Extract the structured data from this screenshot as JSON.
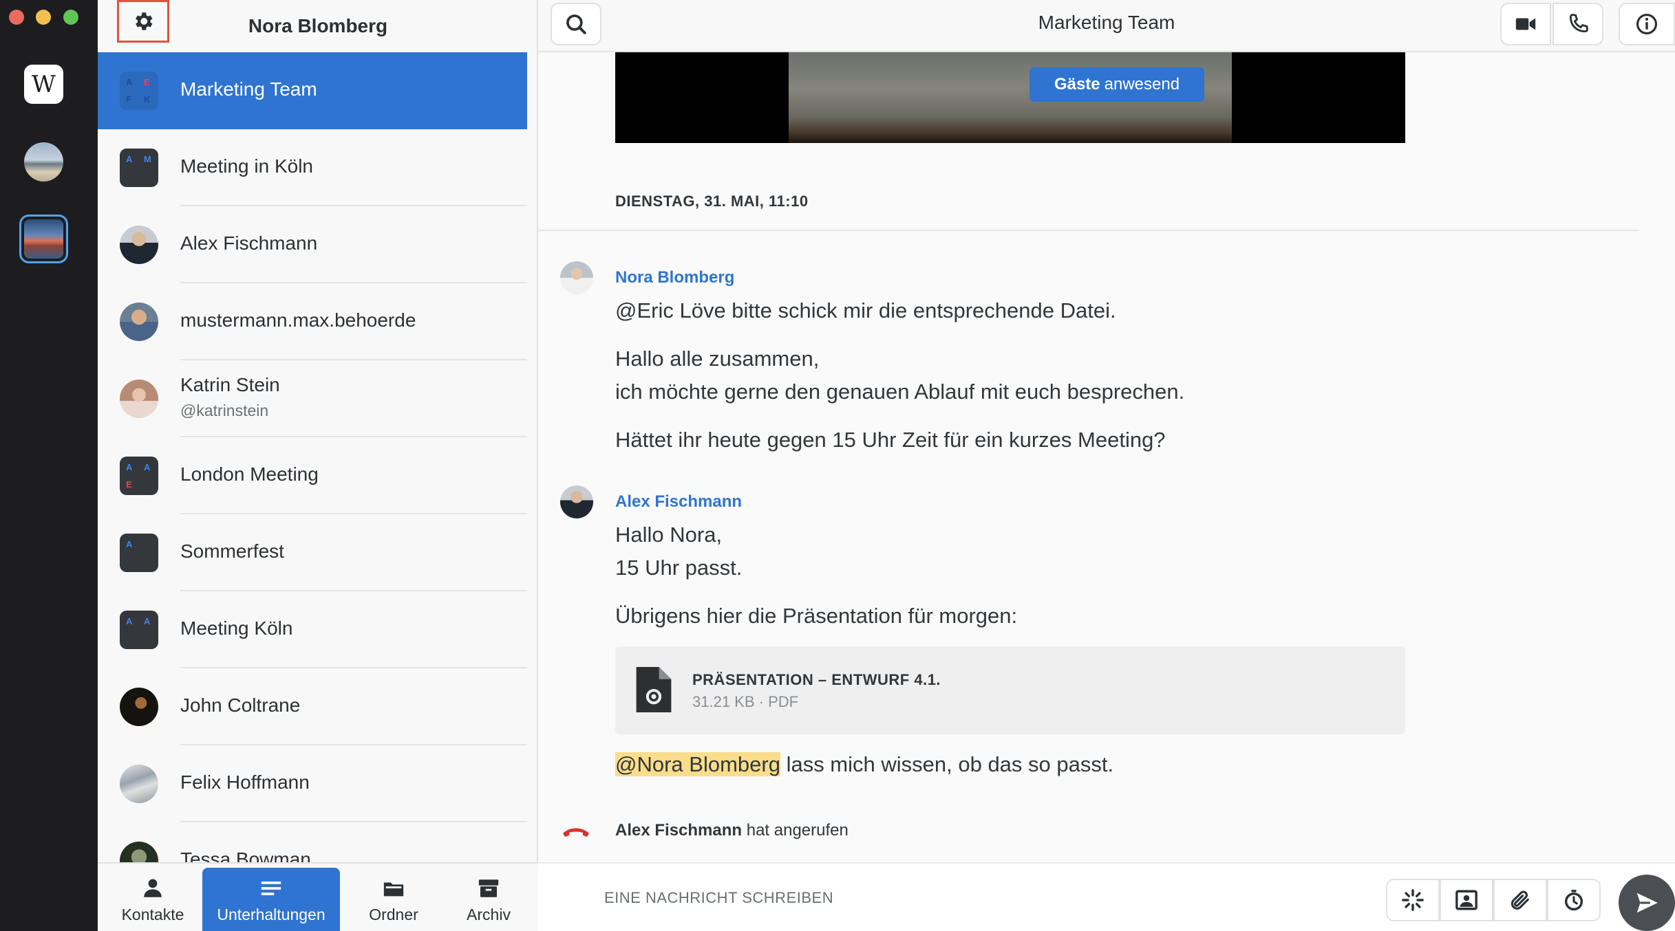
{
  "sidebar": {
    "header_title": "Nora Blomberg",
    "conversations": [
      {
        "name": "Marketing Team",
        "sub": "",
        "type": "group",
        "initials": [
          "A",
          "E",
          "F",
          "K"
        ],
        "active": true
      },
      {
        "name": "Meeting in Köln",
        "sub": "",
        "type": "group",
        "initials": [
          "A",
          "M"
        ]
      },
      {
        "name": "Alex Fischmann",
        "sub": "",
        "type": "person"
      },
      {
        "name": "mustermann.max.behoerde",
        "sub": "",
        "type": "person"
      },
      {
        "name": "Katrin Stein",
        "sub": "@katrinstein",
        "type": "person"
      },
      {
        "name": "London Meeting",
        "sub": "",
        "type": "group",
        "initials": [
          "A",
          "A",
          "E"
        ]
      },
      {
        "name": "Sommerfest",
        "sub": "",
        "type": "group",
        "initials": [
          "A"
        ]
      },
      {
        "name": "Meeting Köln",
        "sub": "",
        "type": "group",
        "initials": [
          "A",
          "A"
        ]
      },
      {
        "name": "John Coltrane",
        "sub": "",
        "type": "person"
      },
      {
        "name": "Felix Hoffmann",
        "sub": "",
        "type": "person"
      },
      {
        "name": "Tessa Bowman",
        "sub": "",
        "type": "person"
      }
    ],
    "nav": [
      {
        "label": "Kontakte",
        "icon": "person-icon"
      },
      {
        "label": "Unterhaltungen",
        "icon": "conversations-icon",
        "active": true
      },
      {
        "label": "Ordner",
        "icon": "folder-icon"
      },
      {
        "label": "Archiv",
        "icon": "archive-icon"
      }
    ]
  },
  "rail": {
    "app_logo": "W"
  },
  "main": {
    "title": "Marketing Team",
    "guests_badge": {
      "strong": "Gäste",
      "rest": "anwesend"
    },
    "date_separator": "DIENSTAG, 31. MAI, 11:10",
    "messages": [
      {
        "sender": "Nora Blomberg",
        "lines": [
          "@Eric Löve bitte schick mir die entsprechende Datei.",
          "Hallo alle zusammen,",
          "ich möchte gerne den genauen Ablauf mit euch besprechen.",
          "Hättet ihr heute gegen 15 Uhr Zeit für ein kurzes Meeting?"
        ]
      },
      {
        "sender": "Alex Fischmann",
        "lines": [
          "Hallo Nora,",
          "15 Uhr passt.",
          "Übrigens hier die Präsentation für morgen:"
        ]
      }
    ],
    "file": {
      "name": "PRÄSENTATION – ENTWURF 4.1.",
      "meta": "31.21 KB · PDF"
    },
    "mention": {
      "tag": "@Nora Blomberg",
      "rest": " lass mich wissen, ob das so passt."
    },
    "call_event": {
      "name": "Alex Fischmann",
      "rest": " hat angerufen"
    },
    "composer": {
      "placeholder": "EINE NACHRICHT SCHREIBEN"
    }
  },
  "colors": {
    "accent": "#2f74d0",
    "rail": "#1d1d1f",
    "mention_highlight": "#f9dd8a",
    "call_red": "#d8342c",
    "settings_outline": "#e0533d"
  }
}
